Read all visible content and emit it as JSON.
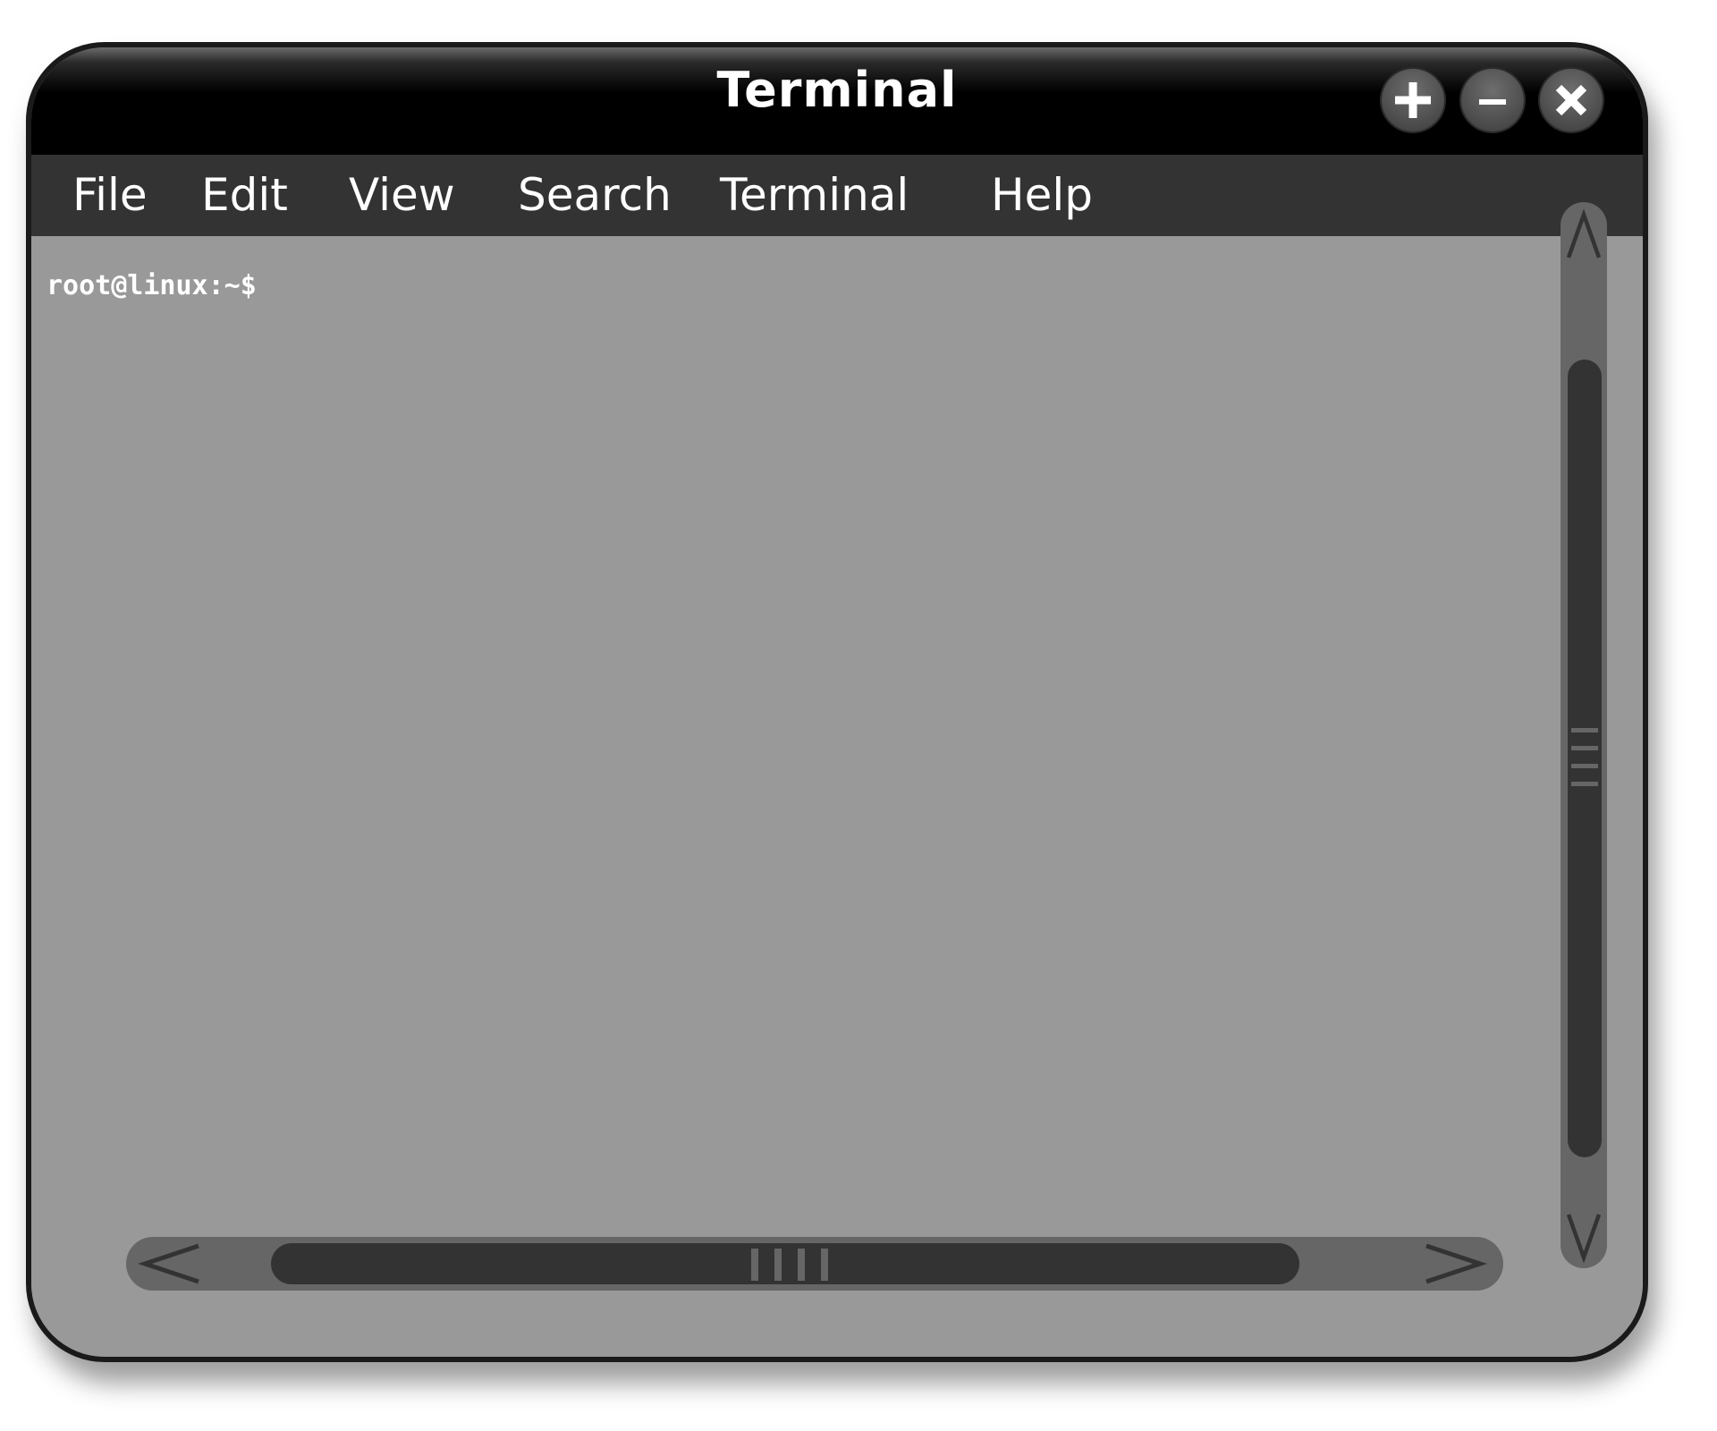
{
  "window": {
    "title": "Terminal",
    "controls": [
      {
        "name": "add-tab",
        "icon": "plus-icon"
      },
      {
        "name": "minimize",
        "icon": "minus-icon"
      },
      {
        "name": "close",
        "icon": "close-icon"
      }
    ]
  },
  "menu": {
    "items": [
      "File",
      "Edit",
      "View",
      "Search",
      "Terminal",
      "Help"
    ]
  },
  "terminal": {
    "prompt": "root@linux:~$"
  },
  "colors": {
    "titlebar": "#000000",
    "menubar": "#333333",
    "terminal_bg": "#999999",
    "scroll_track": "#666666",
    "scroll_thumb": "#333333",
    "text": "#ffffff"
  }
}
